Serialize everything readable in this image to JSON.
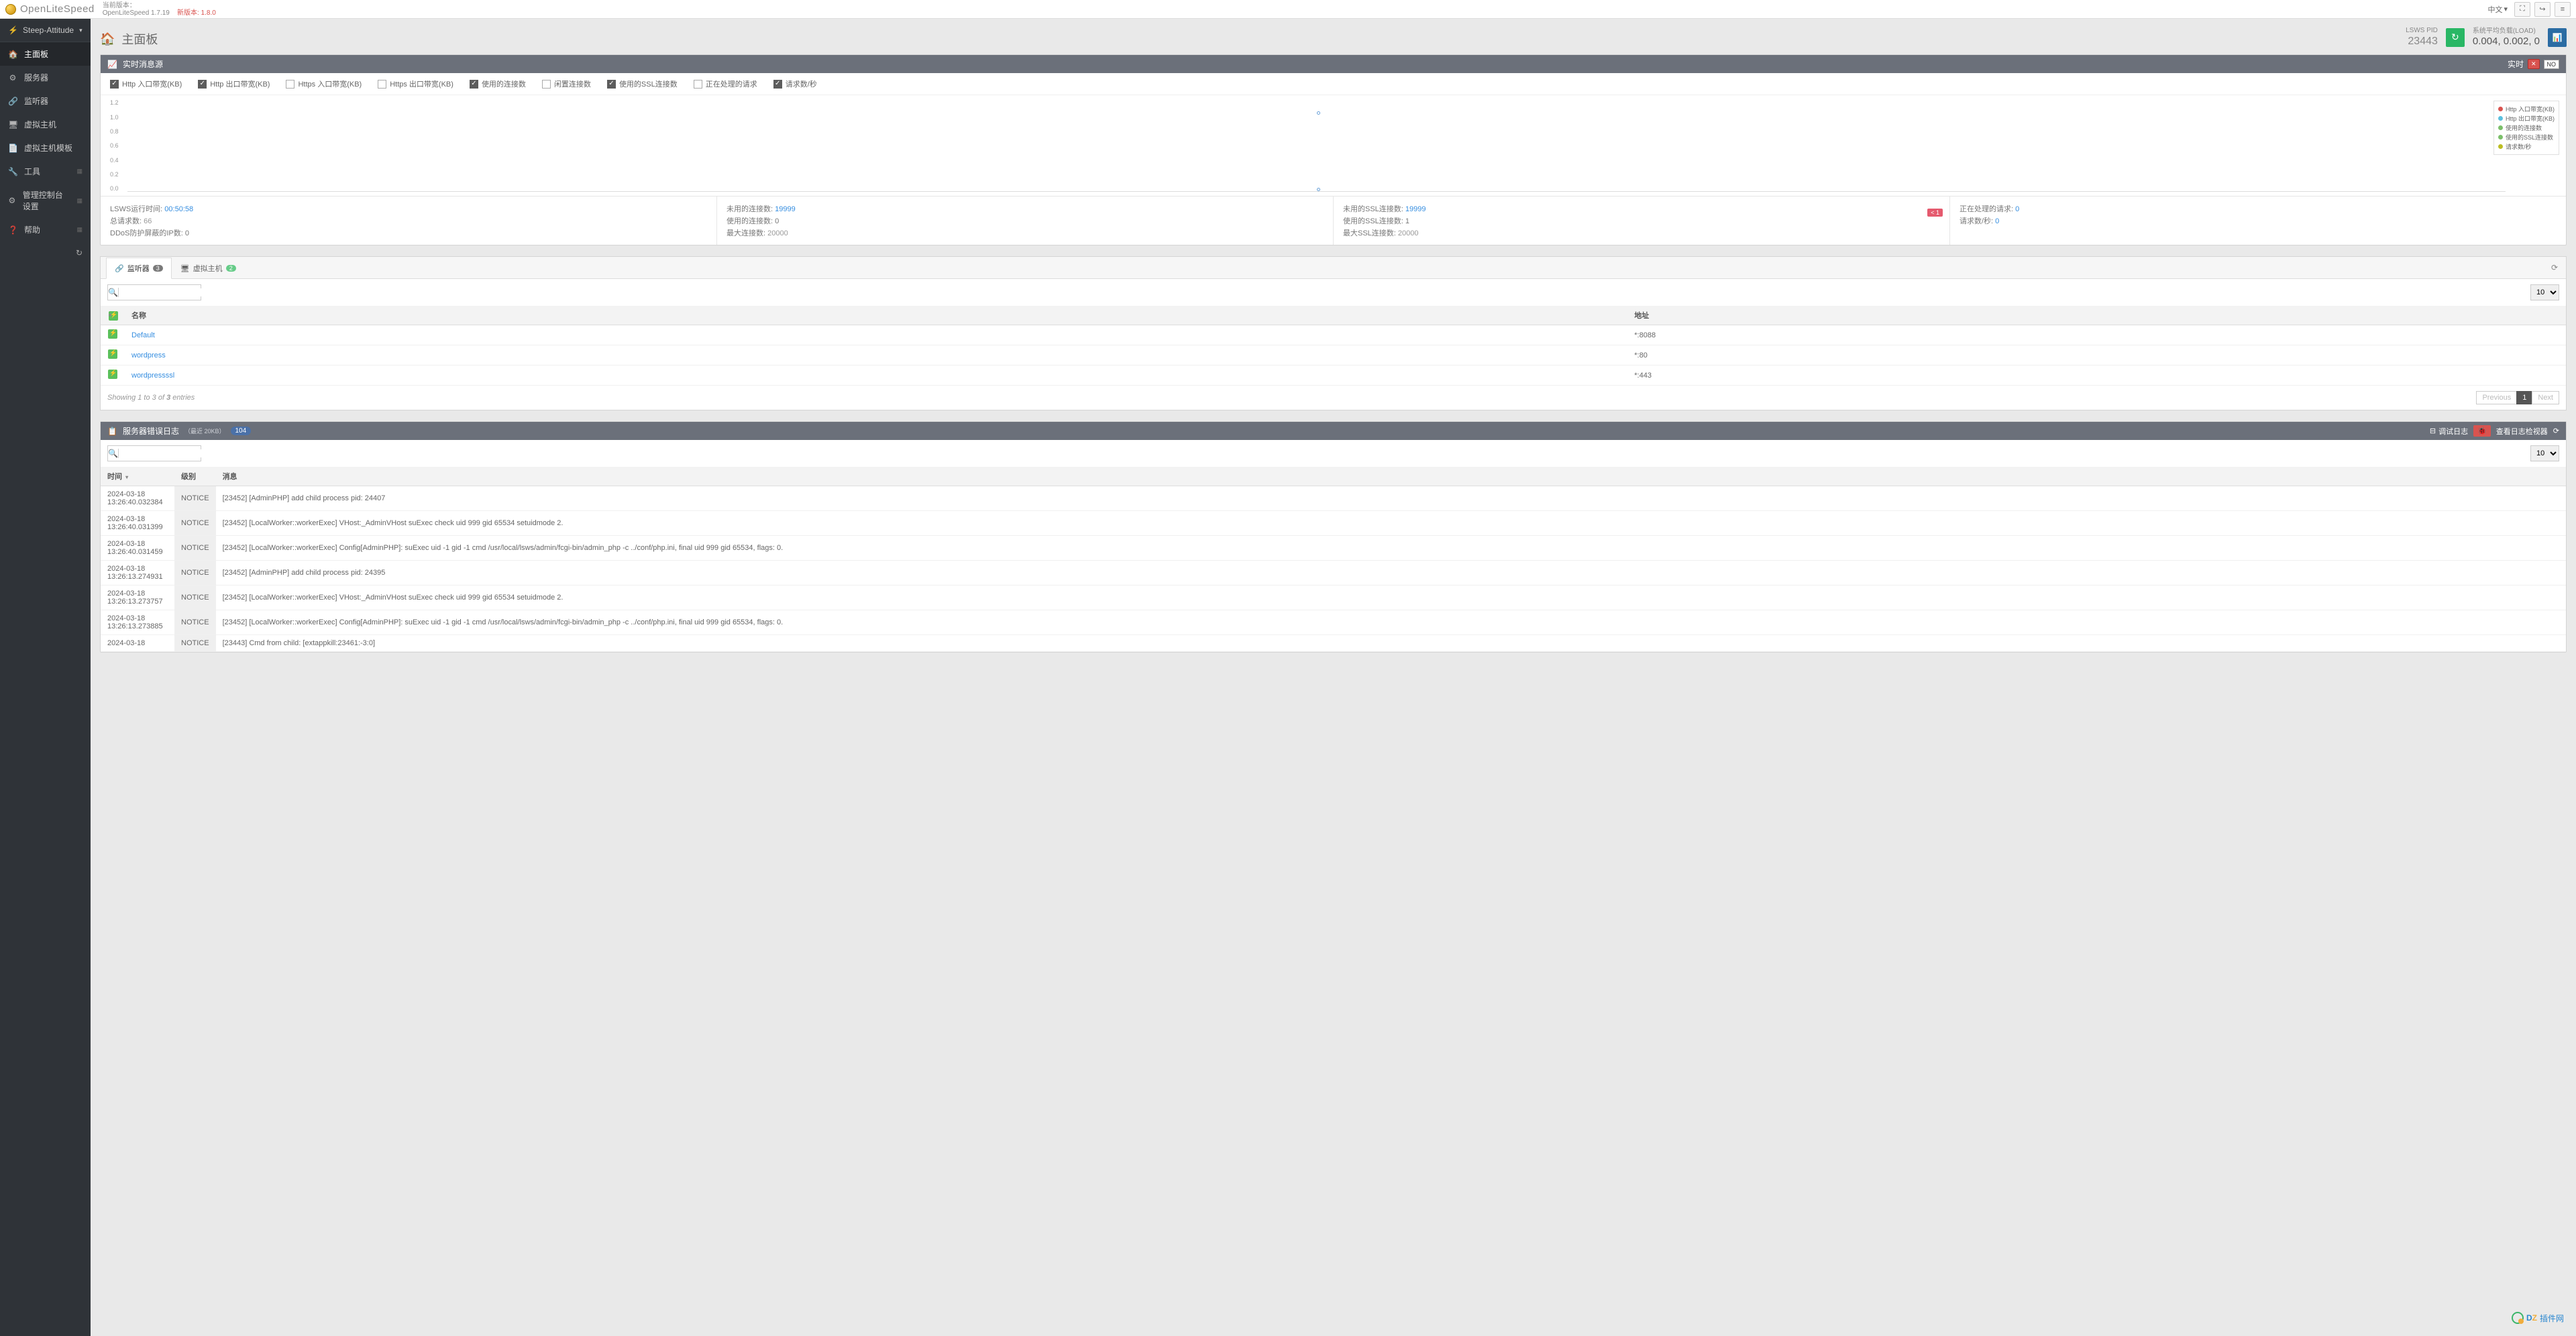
{
  "header": {
    "brand": "OpenLiteSpeed",
    "current_version_label": "当前版本：",
    "current_version": "OpenLiteSpeed 1.7.19",
    "new_version_label": "新版本:",
    "new_version": "1.8.0",
    "lang": "中文"
  },
  "sidebar": {
    "server_selector_icon": "⚡",
    "server_selector": "Steep-Attitude",
    "items": [
      {
        "icon": "🏠",
        "label": "主面板",
        "active": true
      },
      {
        "icon": "⚙",
        "label": "服务器"
      },
      {
        "icon": "🔗",
        "label": "监听器"
      },
      {
        "icon": "🖥",
        "label": "虚拟主机"
      },
      {
        "icon": "📄",
        "label": "虚拟主机模板"
      },
      {
        "icon": "🔧",
        "label": "工具",
        "expandable": true
      },
      {
        "icon": "⚙",
        "label": "管理控制台设置",
        "expandable": true
      },
      {
        "icon": "❓",
        "label": "帮助",
        "expandable": true
      }
    ]
  },
  "page": {
    "title": "主面板",
    "pid_label": "LSWS PID",
    "pid_value": "23443",
    "load_label": "系统平均负载(LOAD)",
    "load_value": "0.004, 0.002, 0"
  },
  "realtime_panel": {
    "title": "实时消息源",
    "live_label": "实时",
    "live_off": "NO",
    "checkboxes": [
      {
        "label": "Http 入口带宽(KB)",
        "on": true
      },
      {
        "label": "Http 出口带宽(KB)",
        "on": true
      },
      {
        "label": "Https 入口带宽(KB)",
        "on": false
      },
      {
        "label": "Https 出口带宽(KB)",
        "on": false
      },
      {
        "label": "使用的连接数",
        "on": true
      },
      {
        "label": "闲置连接数",
        "on": false
      },
      {
        "label": "使用的SSL连接数",
        "on": true
      },
      {
        "label": "正在处理的请求",
        "on": false
      },
      {
        "label": "请求数/秒",
        "on": true
      }
    ],
    "legend": [
      {
        "label": "Http 入口带宽(KB)",
        "color": "#d9534f"
      },
      {
        "label": "Http 出口带宽(KB)",
        "color": "#5bc0de"
      },
      {
        "label": "使用的连接数",
        "color": "#7bbf6a"
      },
      {
        "label": "使用的SSL连接数",
        "color": "#7bbf6a"
      },
      {
        "label": "请求数/秒",
        "color": "#bcbd22"
      }
    ],
    "stats": {
      "col1": [
        {
          "label": "LSWS运行时间: ",
          "value": "00:50:58",
          "link": true
        },
        {
          "label": "总请求数: ",
          "value": "66",
          "muted": true
        },
        {
          "label": "DDoS防护屏蔽的IP数: ",
          "value": "0"
        }
      ],
      "col2": [
        {
          "label": "未用的连接数: ",
          "value": "19999",
          "link": true
        },
        {
          "label": "使用的连接数: ",
          "value": "0"
        },
        {
          "label": "最大连接数: ",
          "value": "20000",
          "muted": true
        }
      ],
      "col3": [
        {
          "label": "未用的SSL连接数: ",
          "value": "19999",
          "link": true
        },
        {
          "label": "使用的SSL连接数: ",
          "value": "1"
        },
        {
          "label": "最大SSL连接数: ",
          "value": "20000",
          "muted": true
        }
      ],
      "col3_badge": "< 1",
      "col4": [
        {
          "label": "正在处理的请求: ",
          "value": "0",
          "link": true
        },
        {
          "label": "请求数/秒: ",
          "value": "0",
          "link": true
        }
      ]
    }
  },
  "chart_data": {
    "type": "line",
    "title": "",
    "xlabel": "",
    "ylabel": "",
    "ylim": [
      0,
      1.2
    ],
    "yticks": [
      "1.2",
      "1.0",
      "0.8",
      "0.6",
      "0.4",
      "0.2",
      "0.0"
    ],
    "points": [
      {
        "x_pct": 50,
        "y": 1.0,
        "series": "使用的SSL连接数"
      },
      {
        "x_pct": 50,
        "y": 0.0,
        "series": "Http 入口带宽(KB)"
      }
    ]
  },
  "listeners_panel": {
    "tabs": [
      {
        "icon": "🔗",
        "label": "监听器",
        "badge": "3",
        "active": true
      },
      {
        "icon": "🖥",
        "label": "虚拟主机",
        "badge": "2",
        "badge_class": "green"
      }
    ],
    "pagesize": "10",
    "columns": [
      "名称",
      "地址"
    ],
    "rows": [
      {
        "name": "Default",
        "addr": "*:8088"
      },
      {
        "name": "wordpress",
        "addr": "*:80"
      },
      {
        "name": "wordpressssl",
        "addr": "*:443"
      }
    ],
    "showing_prefix": "Showing 1 to 3 of ",
    "showing_total": "3",
    "showing_suffix": " entries",
    "prev": "Previous",
    "page": "1",
    "next": "Next"
  },
  "log_panel": {
    "title": "服务器错误日志",
    "subtitle": "（最近 20KB）",
    "count": "104",
    "debug_label": "调试日志",
    "viewer_label": "查看日志检视器",
    "pagesize": "10",
    "columns": [
      "时间",
      "级别",
      "消息"
    ],
    "rows": [
      {
        "time": "2024-03-18 13:26:40.032384",
        "level": "NOTICE",
        "msg": "[23452] [AdminPHP] add child process pid: 24407"
      },
      {
        "time": "2024-03-18 13:26:40.031399",
        "level": "NOTICE",
        "msg": "[23452] [LocalWorker::workerExec] VHost:_AdminVHost suExec check uid 999 gid 65534 setuidmode 2."
      },
      {
        "time": "2024-03-18 13:26:40.031459",
        "level": "NOTICE",
        "msg": "[23452] [LocalWorker::workerExec] Config[AdminPHP]: suExec uid -1 gid -1 cmd /usr/local/lsws/admin/fcgi-bin/admin_php -c ../conf/php.ini, final uid 999 gid 65534, flags: 0."
      },
      {
        "time": "2024-03-18 13:26:13.274931",
        "level": "NOTICE",
        "msg": "[23452] [AdminPHP] add child process pid: 24395"
      },
      {
        "time": "2024-03-18 13:26:13.273757",
        "level": "NOTICE",
        "msg": "[23452] [LocalWorker::workerExec] VHost:_AdminVHost suExec check uid 999 gid 65534 setuidmode 2."
      },
      {
        "time": "2024-03-18 13:26:13.273885",
        "level": "NOTICE",
        "msg": "[23452] [LocalWorker::workerExec] Config[AdminPHP]: suExec uid -1 gid -1 cmd /usr/local/lsws/admin/fcgi-bin/admin_php -c ../conf/php.ini, final uid 999 gid 65534, flags: 0."
      },
      {
        "time": "2024-03-18",
        "level": "NOTICE",
        "msg": "[23443] Cmd from child: [extappkill:23461:-3:0]"
      }
    ]
  },
  "watermark": {
    "dz": "DZ",
    "text": "插件网"
  }
}
